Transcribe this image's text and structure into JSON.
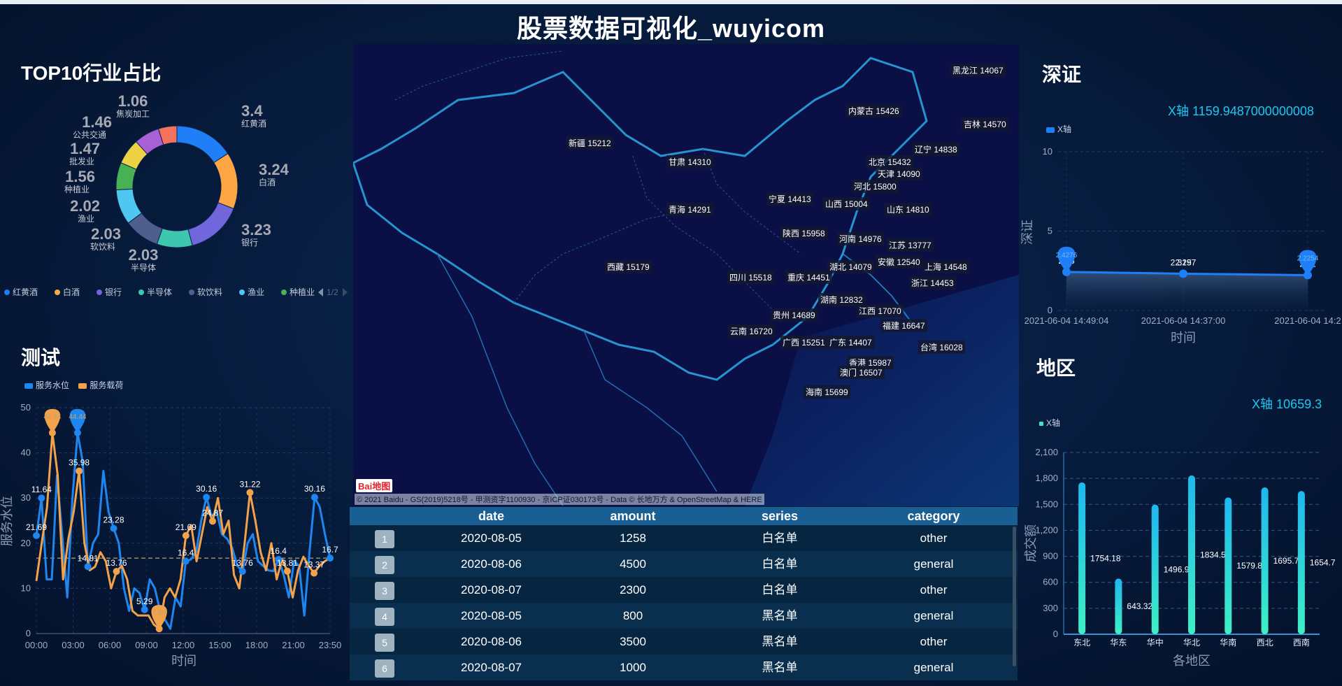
{
  "page": {
    "title": "股票数据可视化_wuyicom"
  },
  "pie": {
    "title": "TOP10行业占比",
    "legend_page": "1/2",
    "colors": [
      "#1e7ff6",
      "#ffa644",
      "#7166dc",
      "#3fc6b0",
      "#4f5f8d",
      "#4fc7f1",
      "#47b253",
      "#edd344",
      "#a960d6",
      "#f4715e"
    ],
    "chart_data": {
      "type": "pie",
      "labels": [
        "红黄酒",
        "白酒",
        "银行",
        "半导体",
        "软饮料",
        "渔业",
        "种植业",
        "批发业",
        "公共交通",
        "焦炭加工"
      ],
      "values": [
        3.4,
        3.24,
        3.23,
        2.03,
        2.03,
        2.02,
        1.56,
        1.47,
        1.46,
        1.06
      ],
      "legend_visible": [
        "红黄酒",
        "白酒",
        "银行",
        "半导体",
        "软饮料",
        "渔业",
        "种植业"
      ]
    }
  },
  "line": {
    "title": "测试",
    "legend": [
      "服务水位",
      "服务载荷"
    ],
    "colors": [
      "#1e86f0",
      "#f2a24a"
    ],
    "chart_data": {
      "type": "line",
      "x_ticks": [
        "00:00",
        "03:00",
        "06:00",
        "09:00",
        "12:00",
        "15:00",
        "18:00",
        "21:00",
        "23:50"
      ],
      "xlabel": "时间",
      "ylabel": "服务水位",
      "ylim": [
        0,
        50
      ],
      "y_ticks": [
        0,
        10,
        20,
        30,
        40,
        50
      ],
      "series": [
        {
          "name": "服务水位",
          "values": [
            21.69,
            30,
            12,
            12,
            35,
            22,
            8,
            30,
            44.44,
            38,
            14.81,
            20,
            22,
            36,
            27,
            23.28,
            20,
            10,
            5,
            10,
            9,
            5.29,
            12,
            10,
            5,
            3,
            1.06,
            8,
            6,
            16,
            16.4,
            18,
            25,
            30.16,
            26,
            27,
            22,
            21,
            19,
            15,
            13.76,
            20,
            22,
            16,
            15,
            14,
            13.81,
            16.4,
            13,
            8,
            16,
            15,
            4,
            18,
            30.16,
            28,
            22,
            16.7
          ]
        },
        {
          "name": "服务载荷",
          "values": [
            11.64,
            20,
            28,
            44.44,
            35,
            12,
            21,
            27,
            35.98,
            20,
            14,
            14.81,
            18,
            16,
            10,
            13.76,
            15,
            12,
            5,
            4,
            4,
            4,
            2,
            1.06,
            8,
            10,
            8,
            12,
            21.69,
            24,
            16,
            22,
            28,
            24.87,
            30,
            22,
            25,
            13,
            10,
            20,
            31.22,
            25,
            18,
            14,
            20,
            12,
            16.4,
            13.81,
            8,
            14,
            17,
            15,
            13.37,
            15,
            16,
            16.7
          ]
        }
      ],
      "data_labels": [
        {
          "text": "21.69"
        },
        {
          "text": "11.64"
        },
        {
          "text": "44.44"
        },
        {
          "text": "44.44"
        },
        {
          "text": "35.98"
        },
        {
          "text": "14.81"
        },
        {
          "text": "23.28"
        },
        {
          "text": "13.76"
        },
        {
          "text": "5.29"
        },
        {
          "text": "1.06"
        },
        {
          "text": "21.69"
        },
        {
          "text": "16.4"
        },
        {
          "text": "30.16"
        },
        {
          "text": "24.87"
        },
        {
          "text": "31.22"
        },
        {
          "text": "13.76"
        },
        {
          "text": "16.4"
        },
        {
          "text": "13.81"
        },
        {
          "text": "30.16"
        },
        {
          "text": "13.37"
        },
        {
          "text": "16.7"
        }
      ]
    }
  },
  "shenzheng": {
    "title": "深证",
    "x_value_label": "X轴",
    "x_value": "1159.9487000000008",
    "legend": "X轴",
    "chart_data": {
      "type": "area",
      "categories": [
        "2021-06-04 14:49:04",
        "2021-06-04 14:37:00",
        "2021-06-04 14:2"
      ],
      "values": [
        2.4276,
        2.3197,
        2.2254
      ],
      "data_labels": [
        "2.4276",
        "2.3197",
        "2.2254"
      ],
      "value_labels_under": [
        "2.36",
        "2.25",
        "2.32"
      ],
      "ylim": [
        0,
        10
      ],
      "y_ticks": [
        0,
        5,
        10
      ],
      "xlabel": "时间",
      "ylabel": "深证"
    }
  },
  "region": {
    "title": "地区",
    "x_value_label": "X轴",
    "x_value": "10659.3",
    "legend": "X轴",
    "chart_data": {
      "type": "bar",
      "categories": [
        "东北",
        "华东",
        "华中",
        "华北",
        "华南",
        "西北",
        "西南"
      ],
      "values": [
        1754.18,
        643.32,
        1496.9,
        1834.5,
        1579.8,
        1695.7,
        1654.7
      ],
      "data_labels": [
        "1754.18",
        "643.32",
        "1496.9",
        "1834.5",
        "1579.8",
        "1695.7",
        "1654.7"
      ],
      "ylim": [
        0,
        2100
      ],
      "y_ticks": [
        0,
        300,
        600,
        900,
        "1,200",
        "1,500",
        "1,800",
        "2,100"
      ],
      "xlabel": "各地区",
      "ylabel": "成交额"
    }
  },
  "map": {
    "copyright": "© 2021 Baidu - GS(2019)5218号 - 甲测资字1100930 - 京ICP证030173号 - Data © 长地万方 & OpenStreetMap & HERE",
    "logo": "Bai地图",
    "provinces": [
      {
        "label": "黑龙江 14067"
      },
      {
        "label": "内蒙古 15426"
      },
      {
        "label": "吉林 14570"
      },
      {
        "label": "新疆 15212"
      },
      {
        "label": "甘肃 14310"
      },
      {
        "label": "辽宁 14838"
      },
      {
        "label": "北京 15432"
      },
      {
        "label": "天津 14090"
      },
      {
        "label": "河北 15800"
      },
      {
        "label": "宁夏 14413"
      },
      {
        "label": "山西 15004"
      },
      {
        "label": "青海 14291"
      },
      {
        "label": "山东 14810"
      },
      {
        "label": "陕西 15958"
      },
      {
        "label": "河南 14976"
      },
      {
        "label": "江苏 13777"
      },
      {
        "label": "安徽 12540"
      },
      {
        "label": "西藏 15179"
      },
      {
        "label": "湖北 14079"
      },
      {
        "label": "上海 14548"
      },
      {
        "label": "四川 15518"
      },
      {
        "label": "重庆 14451"
      },
      {
        "label": "浙江 14453"
      },
      {
        "label": "湖南 12832"
      },
      {
        "label": "江西 17070"
      },
      {
        "label": "贵州 14689"
      },
      {
        "label": "福建 16647"
      },
      {
        "label": "云南 16720"
      },
      {
        "label": "广西 15251"
      },
      {
        "label": "广东 14407"
      },
      {
        "label": "台湾 16028"
      },
      {
        "label": "香港 15987"
      },
      {
        "label": "澳门 16507"
      },
      {
        "label": "海南 15699"
      }
    ]
  },
  "table": {
    "columns": [
      "date",
      "amount",
      "series",
      "category"
    ],
    "rows": [
      {
        "rank": "1",
        "date": "2020-08-05",
        "amount": "1258",
        "series": "白名单",
        "category": "other"
      },
      {
        "rank": "2",
        "date": "2020-08-06",
        "amount": "4500",
        "series": "白名单",
        "category": "general"
      },
      {
        "rank": "3",
        "date": "2020-08-07",
        "amount": "2300",
        "series": "白名单",
        "category": "other"
      },
      {
        "rank": "4",
        "date": "2020-08-05",
        "amount": "800",
        "series": "黑名单",
        "category": "general"
      },
      {
        "rank": "5",
        "date": "2020-08-06",
        "amount": "3500",
        "series": "黑名单",
        "category": "other"
      },
      {
        "rank": "6",
        "date": "2020-08-07",
        "amount": "1000",
        "series": "黑名单",
        "category": "general"
      }
    ]
  }
}
